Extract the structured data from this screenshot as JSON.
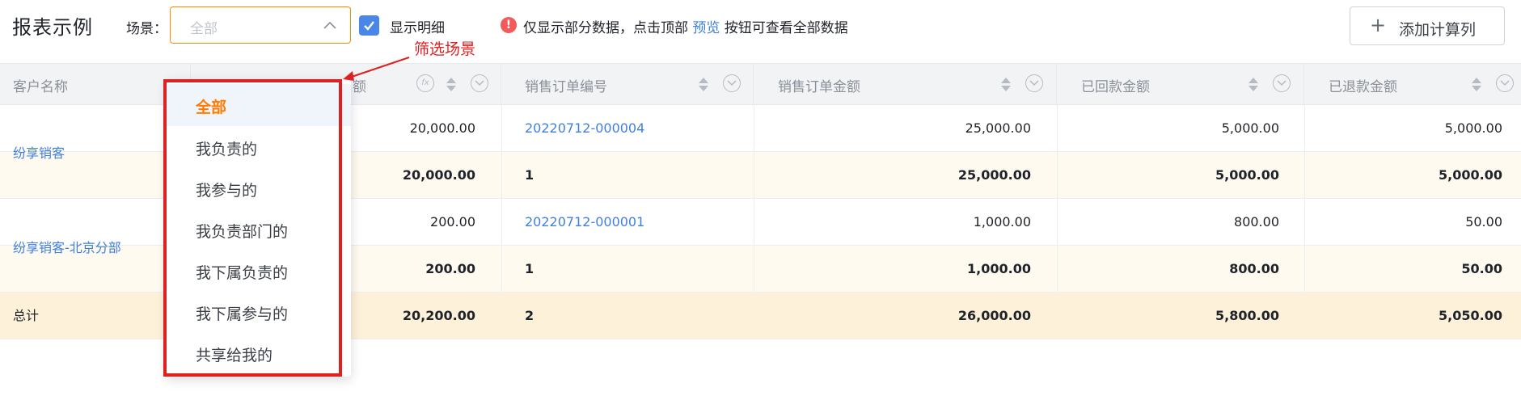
{
  "header": {
    "title": "报表示例",
    "scene_label": "场景：",
    "scene_value": "全部",
    "detail_label": "显示明细",
    "notice_pre": "仅显示部分数据，点击顶部",
    "notice_link": "预览",
    "notice_post": "按钮可查看全部数据",
    "add_column_label": "添加计算列"
  },
  "table": {
    "columns": [
      {
        "label": "客户名称"
      },
      {
        "label": "额"
      },
      {
        "label": "销售订单编号"
      },
      {
        "label": "销售订单金额"
      },
      {
        "label": "已回款金额"
      },
      {
        "label": "已退款金额"
      }
    ],
    "groups": [
      {
        "customer": "纷享销客",
        "detail": {
          "amount": "20,000.00",
          "order_no": "20220712-000004",
          "order_amount": "25,000.00",
          "received": "5,000.00",
          "refunded": "5,000.00"
        },
        "subtotal": {
          "amount": "20,000.00",
          "order_no": "1",
          "order_amount": "25,000.00",
          "received": "5,000.00",
          "refunded": "5,000.00"
        }
      },
      {
        "customer": "纷享销客-北京分部",
        "detail": {
          "amount": "200.00",
          "order_no": "20220712-000001",
          "order_amount": "1,000.00",
          "received": "800.00",
          "refunded": "50.00"
        },
        "subtotal": {
          "amount": "200.00",
          "order_no": "1",
          "order_amount": "1,000.00",
          "received": "800.00",
          "refunded": "50.00"
        }
      }
    ],
    "total": {
      "label": "总计",
      "amount": "20,200.00",
      "order_no": "2",
      "order_amount": "26,000.00",
      "received": "5,800.00",
      "refunded": "5,050.00"
    }
  },
  "dropdown": {
    "options": [
      "全部",
      "我负责的",
      "我参与的",
      "我负责部门的",
      "我下属负责的",
      "我下属参与的",
      "共享给我的"
    ],
    "selected": "全部"
  },
  "annotation": {
    "label": "筛选场景",
    "color": "#e02020"
  },
  "colors": {
    "accent": "#ff8a00",
    "link": "#3f7fe0",
    "subtotal_bg": "#fefaef",
    "total_bg": "#fdf1da"
  }
}
